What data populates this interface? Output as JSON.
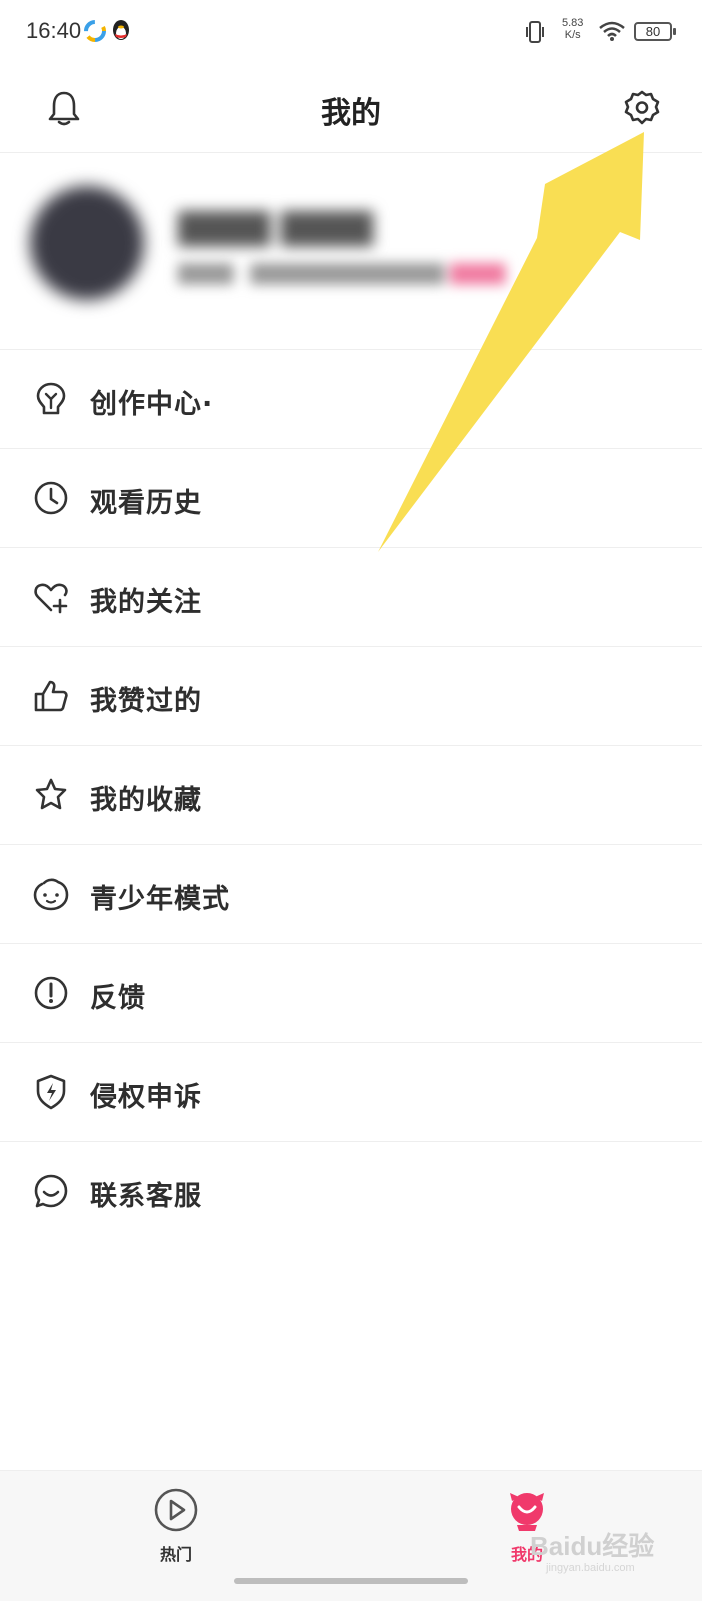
{
  "status_bar": {
    "time": "16:40",
    "network_speed_value": "5.83",
    "network_speed_unit": "K/s",
    "battery": "80"
  },
  "header": {
    "title": "我的",
    "left_icon": "bell-icon",
    "right_icon": "gear-icon"
  },
  "profile": {
    "name": "████ ████",
    "subtitle": "████  ·  ██████████████",
    "subtitle_highlight": "████"
  },
  "menu": {
    "items": [
      {
        "label": "创作中心·",
        "icon": "lightbulb-icon"
      },
      {
        "label": "观看历史",
        "icon": "clock-icon"
      },
      {
        "label": "我的关注",
        "icon": "heart-plus-icon"
      },
      {
        "label": "我赞过的",
        "icon": "thumbs-up-icon"
      },
      {
        "label": "我的收藏",
        "icon": "star-icon"
      },
      {
        "label": "青少年模式",
        "icon": "child-face-icon"
      },
      {
        "label": "反馈",
        "icon": "exclamation-circle-icon"
      },
      {
        "label": "侵权申诉",
        "icon": "shield-bolt-icon"
      },
      {
        "label": "联系客服",
        "icon": "chat-smile-icon"
      }
    ]
  },
  "tabbar": {
    "tabs": [
      {
        "label": "热门",
        "icon": "play-circle-icon",
        "active": false
      },
      {
        "label": "我的",
        "icon": "mascot-icon",
        "active": true
      }
    ]
  },
  "watermark": {
    "text": "Baidu经验",
    "sub": "jingyan.baidu.com"
  },
  "colors": {
    "accent": "#f0396b",
    "arrow": "#f9dc4a",
    "text": "#2e2e2e",
    "divider": "#eeeeee"
  }
}
